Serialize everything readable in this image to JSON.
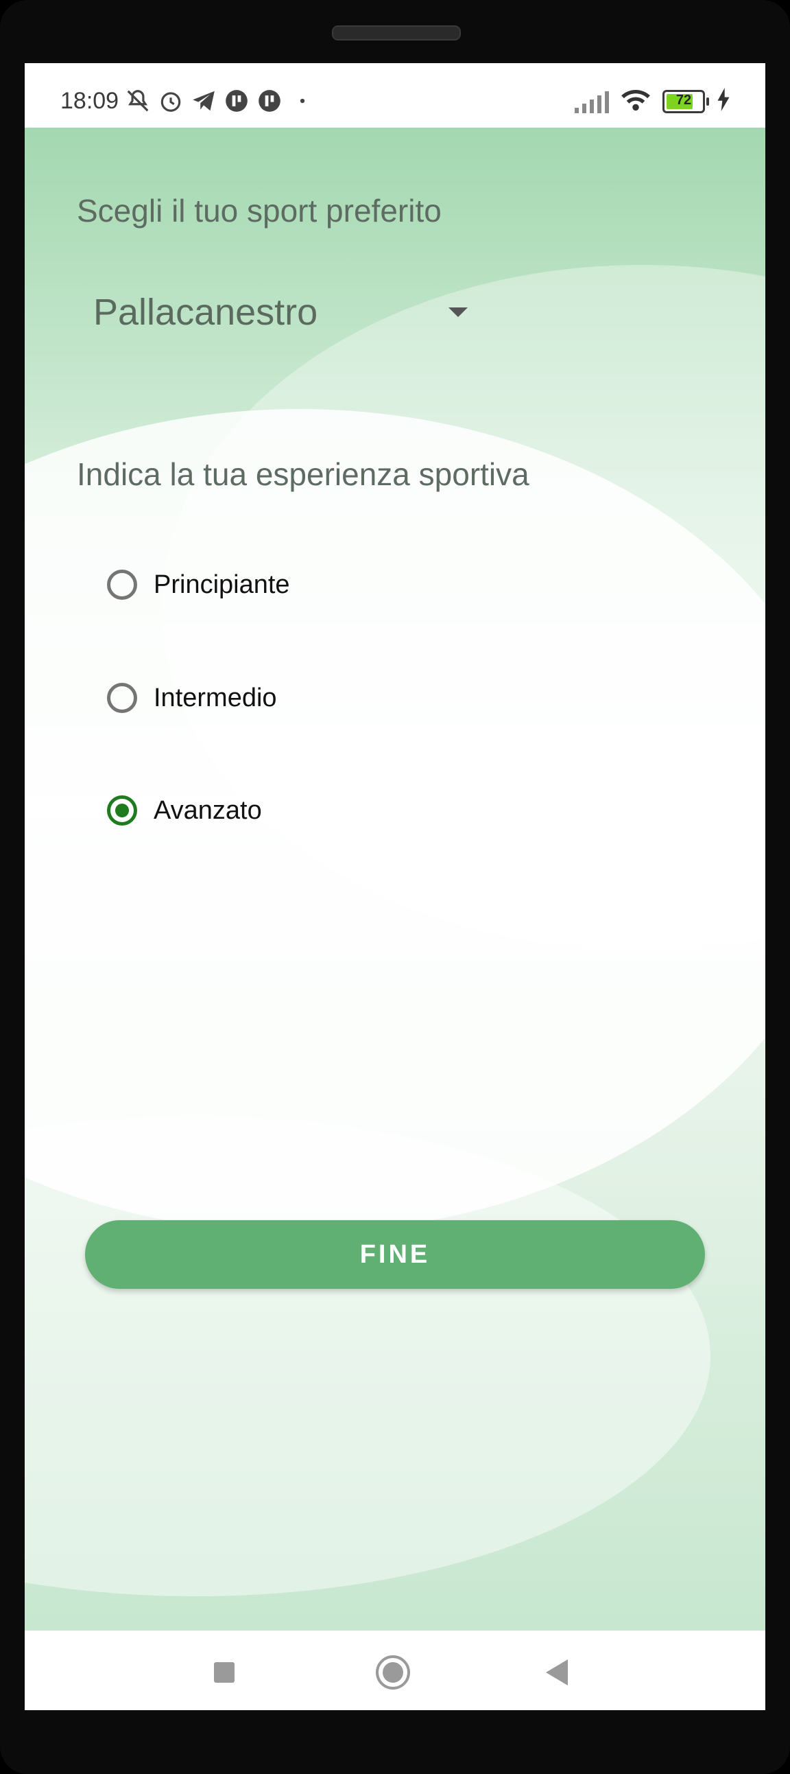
{
  "status_bar": {
    "time": "18:09",
    "left_icons": [
      "mute-icon",
      "alarm-icon",
      "telegram-icon",
      "app-icon",
      "app-icon",
      "dot-icon"
    ],
    "battery_level": "72"
  },
  "screen": {
    "sport_prompt": "Scegli il tuo sport preferito",
    "sport_selected": "Pallacanestro",
    "experience_prompt": "Indica la tua esperienza sportiva",
    "experience_options": [
      {
        "label": "Principiante",
        "checked": false
      },
      {
        "label": "Intermedio",
        "checked": false
      },
      {
        "label": "Avanzato",
        "checked": true
      }
    ],
    "finish_button": "FINE"
  },
  "colors": {
    "accent": "#61b073",
    "radio_checked": "#1e7b1e"
  }
}
